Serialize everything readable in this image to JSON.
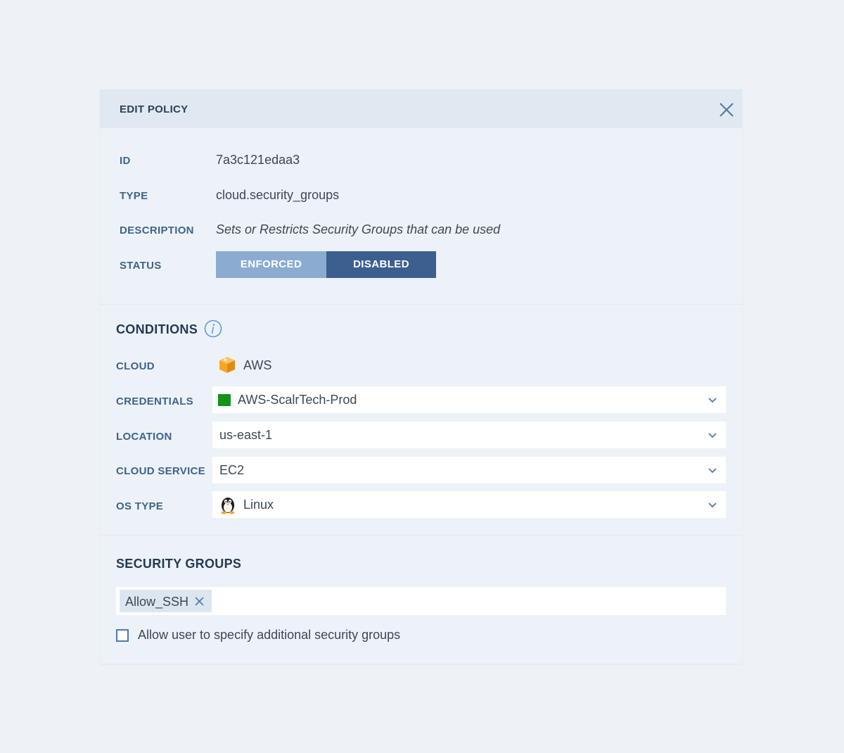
{
  "dialog": {
    "title": "EDIT POLICY"
  },
  "details": {
    "id_label": "ID",
    "id_value": "7a3c121edaa3",
    "type_label": "TYPE",
    "type_value": "cloud.security_groups",
    "description_label": "DESCRIPTION",
    "description_value": "Sets or Restricts Security Groups that can be used",
    "status_label": "STATUS",
    "status_options": [
      "ENFORCED",
      "DISABLED"
    ],
    "status_selected": "DISABLED"
  },
  "conditions": {
    "title": "CONDITIONS",
    "cloud_label": "CLOUD",
    "cloud_value": "AWS",
    "credentials_label": "CREDENTIALS",
    "credentials_value": "AWS-ScalrTech-Prod",
    "location_label": "LOCATION",
    "location_value": "us-east-1",
    "cloud_service_label": "CLOUD SERVICE",
    "cloud_service_value": "EC2",
    "os_type_label": "OS TYPE",
    "os_type_value": "Linux"
  },
  "security_groups": {
    "title": "SECURITY GROUPS",
    "tags": [
      "Allow_SSH"
    ],
    "checkbox_label": "Allow user to specify additional security groups",
    "checkbox_checked": false
  },
  "colors": {
    "accent": "#3d5f8f",
    "accent_light": "#8bacd0",
    "label": "#3e6488",
    "credential_swatch": "#14921a",
    "aws_orange": "#f6a623"
  },
  "icons": {
    "close": "close-icon",
    "info": "info-icon",
    "aws": "aws-box-icon",
    "linux": "tux-penguin-icon",
    "chevron": "chevron-down-icon",
    "tag_remove": "x-icon"
  }
}
